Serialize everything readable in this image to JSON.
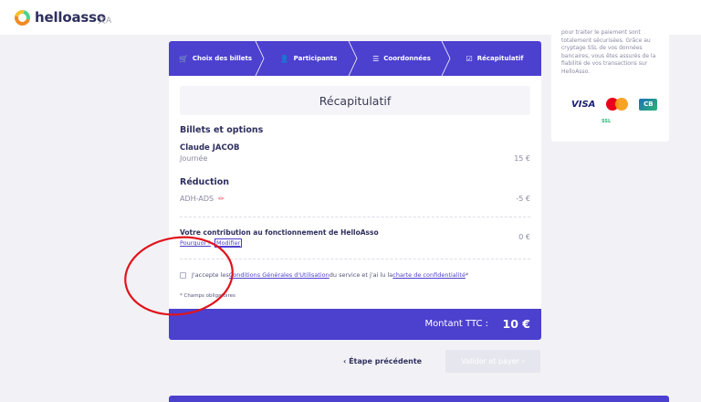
{
  "header": {
    "logo_text": "helloasso",
    "lang_icon": "translate-icon"
  },
  "steps": [
    {
      "label": "Choix des billets",
      "icon": "cart-icon"
    },
    {
      "label": "Participants",
      "icon": "user-icon"
    },
    {
      "label": "Coordonnées",
      "icon": "list-icon"
    },
    {
      "label": "Récapitulatif",
      "icon": "check-square-icon"
    }
  ],
  "recap": {
    "title": "Récapitulatif",
    "tickets_title": "Billets et options",
    "participant_name": "Claude JACOB",
    "ticket_type": "Journée",
    "ticket_price": "15 €",
    "discount_title": "Réduction",
    "discount_code": "ADH-ADS",
    "discount_amount": "-5 €",
    "contribution_title": "Votre contribution au fonctionnement de HelloAsso",
    "why_link": "Pourquoi ?",
    "modify_link": "Modifier",
    "contribution_amount": "0 €",
    "cgu_prefix": "J'accepte les ",
    "cgu_link": "Conditions Générales d'Utilisation",
    "cgu_middle": " du service et j'ai lu la ",
    "privacy_link": "charte de confidentialité",
    "cgu_suffix": " *",
    "required_note": "* Champs obligatoires",
    "total_label": "Montant TTC :",
    "total_value": "10 €"
  },
  "nav": {
    "prev_label": "‹  Étape précédente",
    "next_label": "Valider et payer  ›"
  },
  "sidebar": {
    "security_text_lines": [
      "pour traiter le paiement sont",
      "totalement sécurisées. Grâce au",
      "cryptage SSL de vos données",
      "bancaires, vous êtes assurés de la",
      "fiabilité de vos transactions sur",
      "HelloAsso."
    ],
    "card_logos": {
      "visa": "VISA",
      "cb": "CB",
      "safe": "SSL"
    }
  },
  "colors": {
    "primary": "#4c40cf",
    "annotation": "#e0141c",
    "accent_pencil": "#e84a5f"
  }
}
